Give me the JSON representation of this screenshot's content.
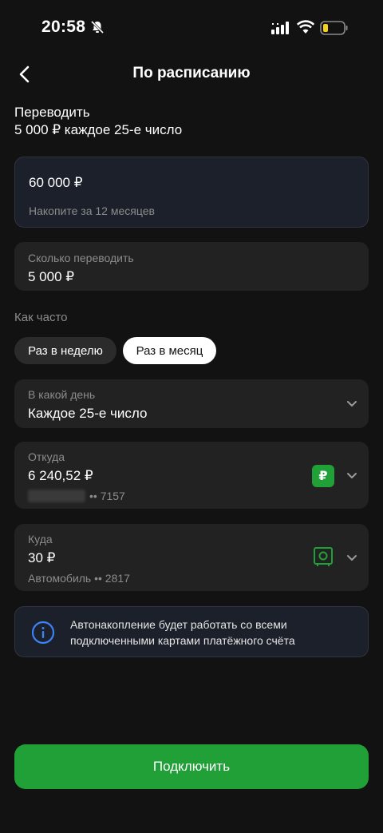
{
  "status_bar": {
    "time": "20:58"
  },
  "header": {
    "title": "По расписанию"
  },
  "summary": {
    "line1": "Переводить",
    "line2": "5 000 ₽ каждое 25-е число"
  },
  "goal": {
    "amount": "60 000 ₽",
    "hint": "Накопите за 12 месяцев"
  },
  "transfer_amount": {
    "label": "Сколько переводить",
    "value": "5 000 ₽"
  },
  "frequency": {
    "label": "Как часто",
    "options": [
      "Раз в неделю",
      "Раз в месяц"
    ],
    "selected": "Раз в месяц"
  },
  "day": {
    "label": "В какой день",
    "value": "Каждое 25-е число"
  },
  "from": {
    "label": "Откуда",
    "balance": "6 240,52 ₽",
    "badge": "₽",
    "card_suffix": "•• 7157"
  },
  "to": {
    "label": "Куда",
    "balance": "30 ₽",
    "account": "Автомобиль •• 2817"
  },
  "info": {
    "text": "Автонакопление будет работать со всеми подключенными картами платёжного счёта"
  },
  "actions": {
    "connect_label": "Подключить"
  },
  "colors": {
    "accent": "#21a038",
    "background": "#121212",
    "card": "#222222",
    "info_bg": "#1b202a",
    "info_icon": "#3b82f6"
  }
}
